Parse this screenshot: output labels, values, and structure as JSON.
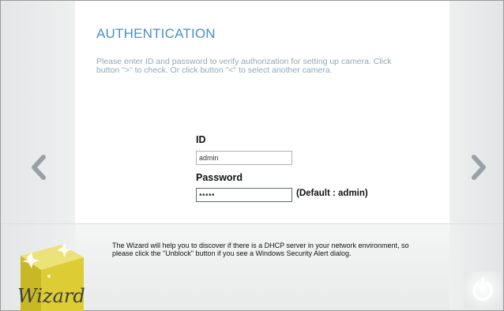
{
  "page": {
    "title": "AUTHENTICATION",
    "instructions": "Please enter ID and password to verify authorization for setting up camera. Click button \">\" to check. Or click button \"<\" to select another camera."
  },
  "form": {
    "id_label": "ID",
    "id_value": "admin",
    "password_label": "Password",
    "password_value": "admin",
    "password_hint": "(Default : admin)"
  },
  "navigation": {
    "prev_icon": "chevron-left-icon",
    "next_icon": "chevron-right-icon"
  },
  "footer": {
    "note": "The Wizard will help you to discover if there is a DHCP server in your network environment, so please click the \"Unblock\" button if you see a Windows Security Alert dialog.",
    "logo_text": "Wizard",
    "power_icon": "power-icon"
  },
  "colors": {
    "title": "#4a8ec4",
    "instructions": "#8fa8bc",
    "logo_box": "#d8c63a"
  }
}
